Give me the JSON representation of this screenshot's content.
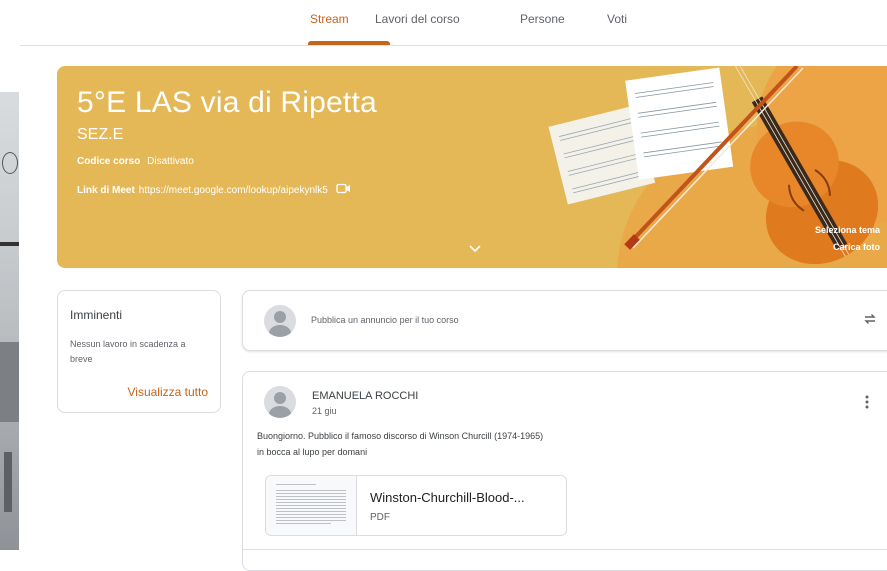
{
  "nav": {
    "tabs": [
      {
        "label": "Stream",
        "active": true
      },
      {
        "label": "Lavori del corso",
        "active": false
      },
      {
        "label": "Persone",
        "active": false
      },
      {
        "label": "Voti",
        "active": false
      }
    ]
  },
  "banner": {
    "title": "5°E LAS via di Ripetta",
    "section": "SEZ.E",
    "code_label": "Codice corso",
    "code_value": "Disattivato",
    "meet_label": "Link di Meet",
    "meet_url": "https://meet.google.com/lookup/aipekynlk5",
    "select_theme": "Seleziona tema",
    "upload_photo": "Carica foto",
    "theme_color": "#e5b857"
  },
  "upcoming": {
    "title": "Imminenti",
    "text": "Nessun lavoro in scadenza a breve",
    "link": "Visualizza tutto"
  },
  "announce": {
    "placeholder": "Pubblica un annuncio per il tuo corso"
  },
  "post": {
    "author": "EMANUELA ROCCHI",
    "date": "21 giu",
    "line1": "Buongiorno.  Pubblico il famoso discorso di Winson Churcill (1974-1965)",
    "line2": "in bocca al lupo per domani",
    "attachment": {
      "title": "Winston-Churchill-Blood-...",
      "type": "PDF"
    }
  },
  "colors": {
    "accent": "#c5641c",
    "banner": "#e5b857"
  }
}
